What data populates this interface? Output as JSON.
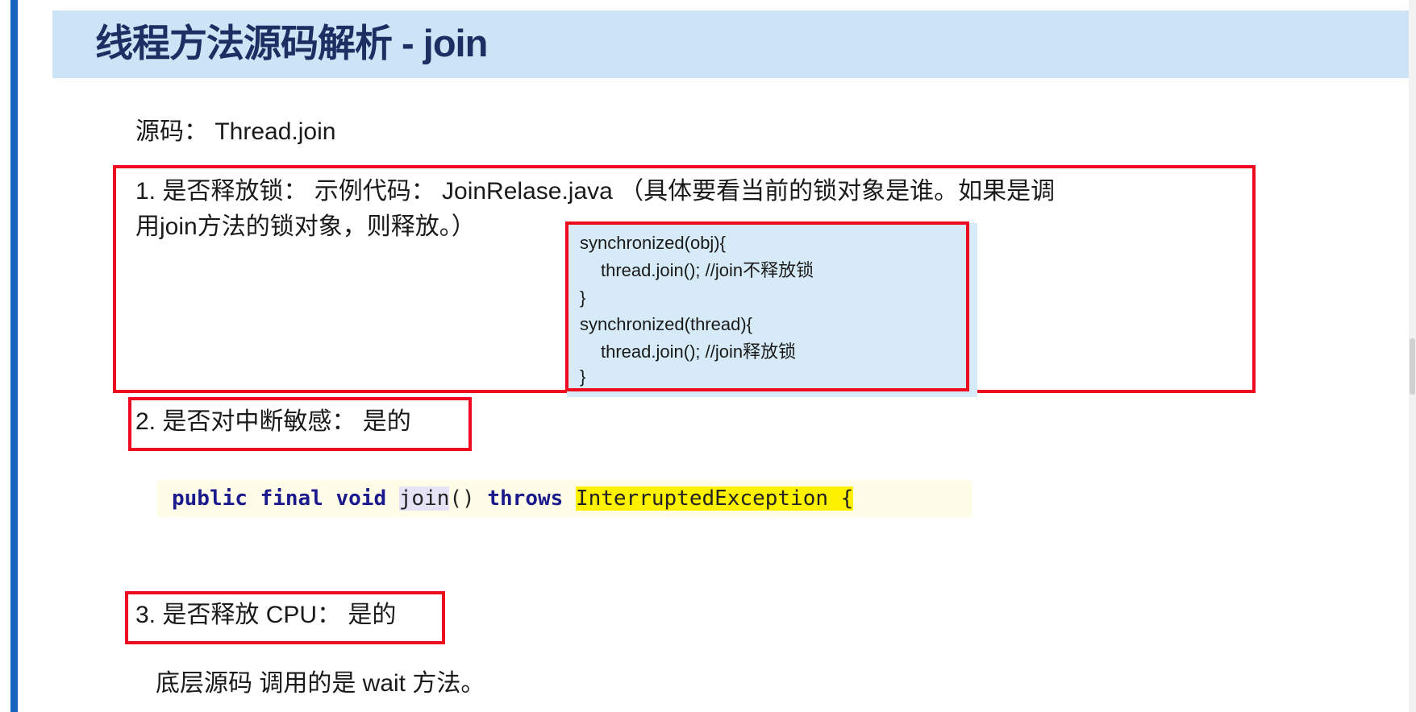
{
  "slide": {
    "title": "线程方法源码解析 - join",
    "source_label": "源码：",
    "source_value": "Thread.join",
    "item1": {
      "line1": "1. 是否释放锁：  示例代码：  JoinRelase.java （具体要看当前的锁对象是谁。如果是调",
      "line2": "用join方法的锁对象，则释放。）"
    },
    "code_example": [
      "synchronized(obj){",
      "thread.join(); //join不释放锁",
      "}",
      "synchronized(thread){",
      "thread.join(); //join释放锁",
      "}"
    ],
    "item2": "2. 是否对中断敏感：  是的",
    "java_signature": {
      "kw1": "public final void ",
      "method": "join",
      "parens": "() ",
      "kw2": "throws",
      "exception": "InterruptedException {"
    },
    "item3": "3. 是否释放 CPU：  是的",
    "footer_note": "底层源码 调用的是 wait 方法。"
  }
}
